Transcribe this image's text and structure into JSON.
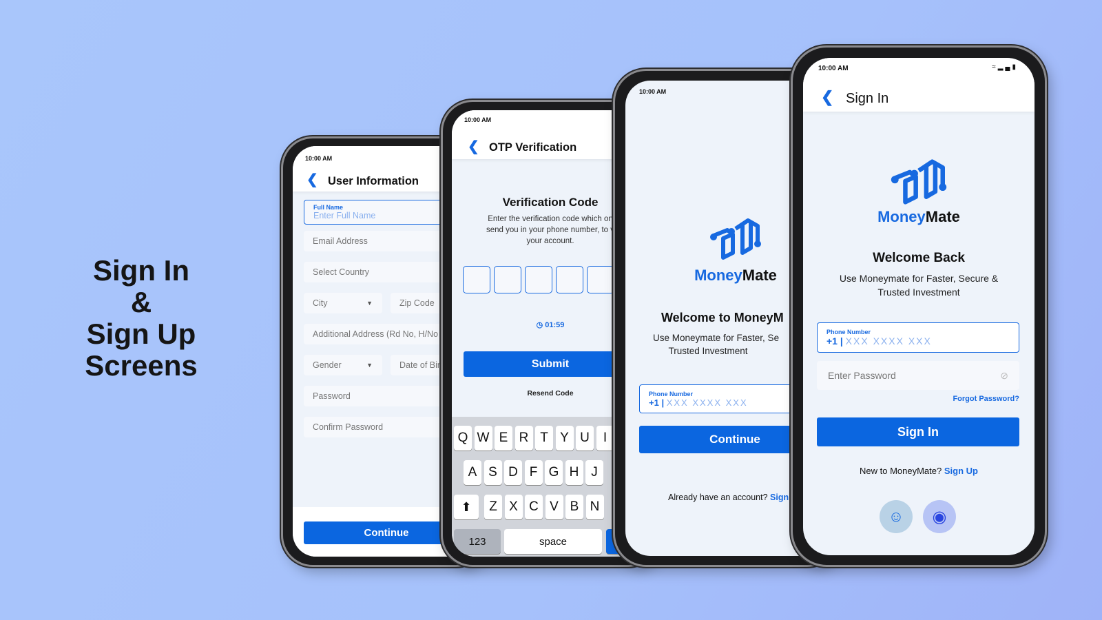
{
  "headline": {
    "line1": "Sign In",
    "line2": "&",
    "line3": "Sign Up Screens"
  },
  "colors": {
    "accent": "#0b66e0",
    "background": "#a9c6fb"
  },
  "status_time": "10:00 AM",
  "user_info": {
    "title": "User Information",
    "full_name_label": "Full Name",
    "full_name_placeholder": "Enter Full Name",
    "email": "Email Address",
    "country": "Select Country",
    "city": "City",
    "zip": "Zip Code",
    "address": "Additional Address (Rd No, H/No",
    "gender": "Gender",
    "dob": "Date of Bir",
    "password": "Password",
    "confirm_password": "Confirm Password",
    "continue": "Continue"
  },
  "otp": {
    "title": "OTP Verification",
    "heading": "Verification Code",
    "desc_line1": "Enter the verification code which on",
    "desc_line2": "send you in your phone number, to v",
    "desc_line3": "your account.",
    "timer": "01:59",
    "submit": "Submit",
    "resend": "Resend Code",
    "keyboard": {
      "row1": [
        "Q",
        "W",
        "E",
        "R",
        "T",
        "Y",
        "U",
        "I"
      ],
      "row2": [
        "A",
        "S",
        "D",
        "F",
        "G",
        "H",
        "J"
      ],
      "row3": [
        "Z",
        "X",
        "C",
        "V",
        "B",
        "N"
      ],
      "num": "123",
      "space": "space"
    }
  },
  "welcome": {
    "brand_a": "Money",
    "brand_b": "Mate",
    "heading": "Welcome to MoneyM",
    "desc_line1": "Use Moneymate for Faster, Se",
    "desc_line2": "Trusted Investment",
    "phone_label": "Phone Number",
    "prefix": "+1",
    "phone_placeholder": "XXX  XXXX  XXX",
    "continue": "Continue",
    "have_account": "Already have an account?",
    "sign_in_link": "Sign"
  },
  "signin": {
    "title": "Sign In",
    "brand_a": "Money",
    "brand_b": "Mate",
    "heading": "Welcome Back",
    "desc_line1": "Use Moneymate for Faster, Secure &",
    "desc_line2": "Trusted Investment",
    "phone_label": "Phone Number",
    "prefix": "+1",
    "phone_placeholder": "XXX  XXXX  XXX",
    "password_placeholder": "Enter Password",
    "forgot": "Forgot Password?",
    "sign_in": "Sign In",
    "new_user": "New to MoneyMate?",
    "sign_up": "Sign Up",
    "icons": [
      "face-id-icon",
      "fingerprint-icon"
    ]
  }
}
